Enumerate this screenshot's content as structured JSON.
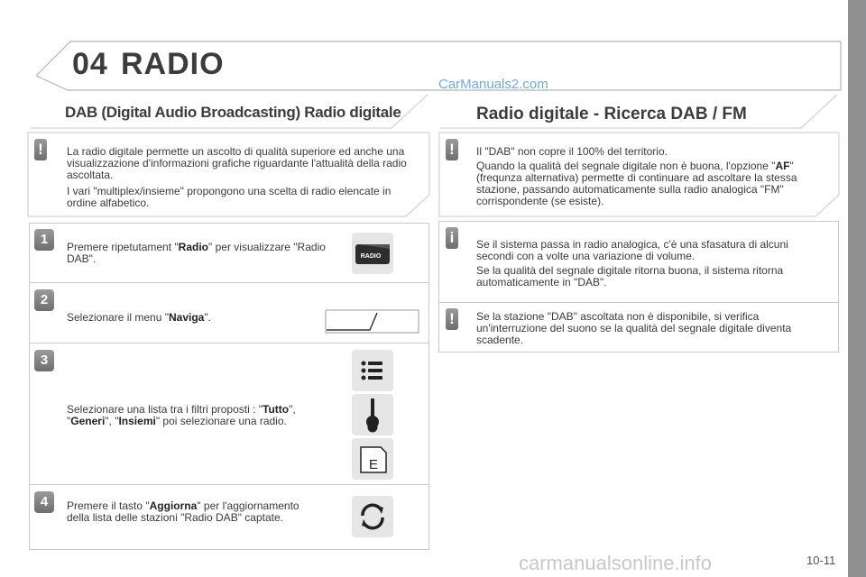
{
  "header": {
    "chapter_number": "04",
    "chapter_title": "RADIO",
    "watermark": "CarManuals2.com"
  },
  "left": {
    "section_title": "DAB (Digital Audio Broadcasting) Radio digitale",
    "intro_p1": "La radio digitale permette un ascolto di qualità superiore ed anche una visualizzazione d'informazioni grafiche riguardante l'attualità della radio ascoltata.",
    "intro_p2": "I vari \"multiplex/insieme\" propongono una scelta di radio elencate in ordine alfabetico.",
    "steps": [
      {
        "number": "1",
        "pre": "Premere ripetutament \"",
        "bold": "Radio",
        "post": "\" per visualizzare \"Radio DAB\".",
        "icon": "radio-button-icon",
        "button_label": "RADIO"
      },
      {
        "number": "2",
        "pre": "Selezionare il menu \"",
        "bold": "Naviga",
        "post": "\".",
        "icon": "naviga-tab-icon"
      },
      {
        "number": "3",
        "pre": "Selezionare una lista tra i filtri proposti : \"",
        "bold": "Tutto",
        "mid1": "\", \"",
        "bold2": "Generi",
        "mid2": "\", \"",
        "bold3": "Insiemi",
        "post": "\" poi selezionare una radio.",
        "icons": [
          "list-icon",
          "guitar-icon",
          "ensemble-icon"
        ],
        "ensemble_letter": "E"
      },
      {
        "number": "4",
        "pre": "Premere il tasto \"",
        "bold": "Aggiorna",
        "post": "\" per l'aggiornamento della lista delle stazioni \"Radio DAB\" captate.",
        "icon": "refresh-icon"
      }
    ]
  },
  "right": {
    "section_title": "Radio digitale - Ricerca DAB / FM",
    "box1_p1": "Il \"DAB\" non copre il 100% del territorio.",
    "box1_p2_pre": "Quando la qualità del segnale digitale non è buona, l'opzione \"",
    "box1_p2_bold": "AF",
    "box1_p2_post": "\" (frequnza alternativa) permette di continuare ad ascoltare la stessa stazione, passando automaticamente sulla radio analogica \"FM\" corrispondente (se esiste).",
    "box2_p1": "Se il sistema passa in radio analogica, c'è una sfasatura di alcuni secondi con a volte una variazione di volume.",
    "box2_p2": "Se la qualità del segnale digitale ritorna buona, il sistema ritorna automaticamente in \"DAB\".",
    "box2_p3": "Se la stazione \"DAB\" ascoltata non è disponibile, si verifica un'interruzione del suono se la qualità del segnale digitale diventa scadente."
  },
  "footer": {
    "page_number": "10-11",
    "watermark": "carmanualsonline.info"
  },
  "colors": {
    "sidebar": "#8f9193",
    "border": "#c9c9c9",
    "watermark": "#5b9bd5"
  }
}
